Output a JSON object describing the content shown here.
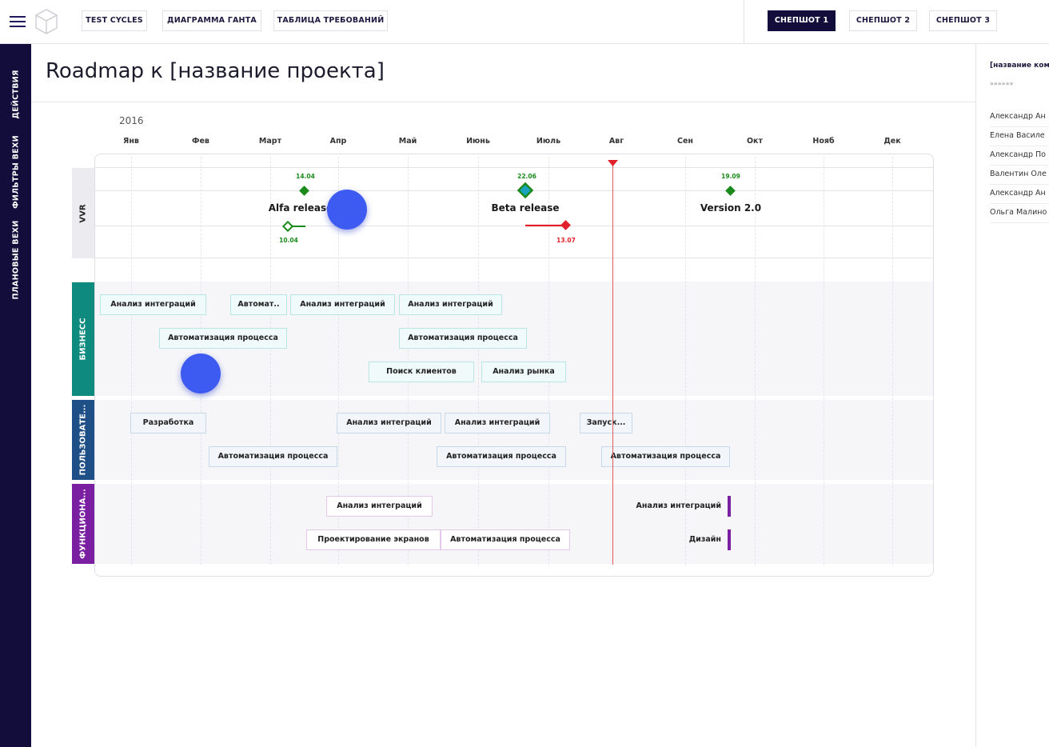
{
  "topbar": {
    "menu_icon": "hamburger-menu-icon",
    "logo_icon": "cube-icon",
    "tabs": [
      "TEST CYCLES",
      "ДИАГРАММА ГАНТА",
      "ТАБЛИЦА ТРЕБОВАНИЙ"
    ],
    "snapshots": [
      "СНЕПШОТ 1",
      "СНЕПШОТ 2",
      "СНЕПШОТ 3"
    ],
    "active_snapshot": "СНЕПШОТ 1"
  },
  "sidebar": {
    "items": [
      "ДЕЙСТВИЯ",
      "ФИЛЬТРЫ ВЕХИ",
      "ПЛАНОВЫЕ ВЕХИ"
    ]
  },
  "page": {
    "title": "Roadmap к [название проекта]"
  },
  "right_panel": {
    "title": "[название ком",
    "subtitle": "»»»»»»",
    "people": [
      "Александр Ан",
      "Елена Василе",
      "Александр По",
      "Валентин Оле",
      "Александр Ан",
      "Ольга Малино"
    ]
  },
  "timeline": {
    "year": "2016",
    "months": [
      "Янв",
      "Фев",
      "Март",
      "Апр",
      "Май",
      "Июнь",
      "Июль",
      "Авг",
      "Сен",
      "Окт",
      "Нояб",
      "Дек"
    ],
    "today_marker": "today-marker",
    "milestones": {
      "lane": "VVR",
      "items": [
        {
          "name": "Alfa release",
          "plan_date": "14.04",
          "actual_date": "10.04"
        },
        {
          "name": "Beta release",
          "plan_date": "22.06",
          "actual_date": "13.07"
        },
        {
          "name": "Version 2.0",
          "plan_date": "19.09"
        }
      ]
    },
    "lanes": [
      {
        "label": "БИЗНЕСС",
        "color": "#0e8a7e",
        "tasks": [
          "Анализ интеграций",
          "Автомат..",
          "Анализ интеграций",
          "Анализ интеграций",
          "Автоматизация процесса",
          "Автоматизация процесса",
          "Поиск клиентов",
          "Анализ рынка"
        ]
      },
      {
        "label": "ПОЛЬЗОВАТЕ...",
        "color": "#1e4f86",
        "tasks": [
          "Разработка",
          "Анализ интеграций",
          "Анализ интеграций",
          "Запуск...",
          "Автоматизация процесса",
          "Автоматизация процесса",
          "Автоматизация процесса"
        ]
      },
      {
        "label": "ФУНКЦИОНА...",
        "color": "#7a1fa2",
        "tasks": [
          "Анализ интеграций",
          "Проектирование экранов",
          "Автоматизация процесса",
          "Анализ интеграций",
          "Дизайн"
        ]
      }
    ]
  },
  "colors": {
    "navy": "#130d3c",
    "plan_green": "#1a8a1a",
    "late_red": "#e0202a",
    "cursor_blue": "#3d5af1"
  }
}
